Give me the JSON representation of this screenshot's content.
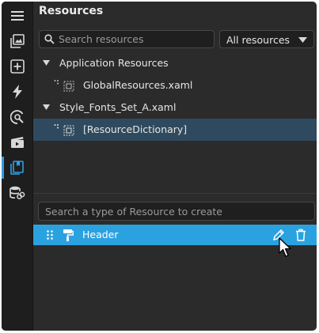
{
  "panel": {
    "title": "Resources"
  },
  "search": {
    "placeholder": "Search resources"
  },
  "filter": {
    "selected": "All resources"
  },
  "tree": {
    "groups": [
      {
        "label": "Application Resources",
        "child": "GlobalResources.xaml"
      },
      {
        "label": "Style_Fonts_Set_A.xaml",
        "child": "[ResourceDictionary]"
      }
    ]
  },
  "create": {
    "placeholder": "Search a type of Resource to create"
  },
  "styles": [
    {
      "label": "Header"
    }
  ],
  "colors": {
    "accent": "#2ba2e0",
    "selected_row": "#2f4a5e",
    "background": "#2b2b2b",
    "rail": "#1e1e1e"
  },
  "rail_icons": [
    "menu-icon",
    "image-gallery-icon",
    "add-box-icon",
    "lightning-icon",
    "speed-gauge-icon",
    "film-icon",
    "resources-icon",
    "database-link-icon"
  ]
}
